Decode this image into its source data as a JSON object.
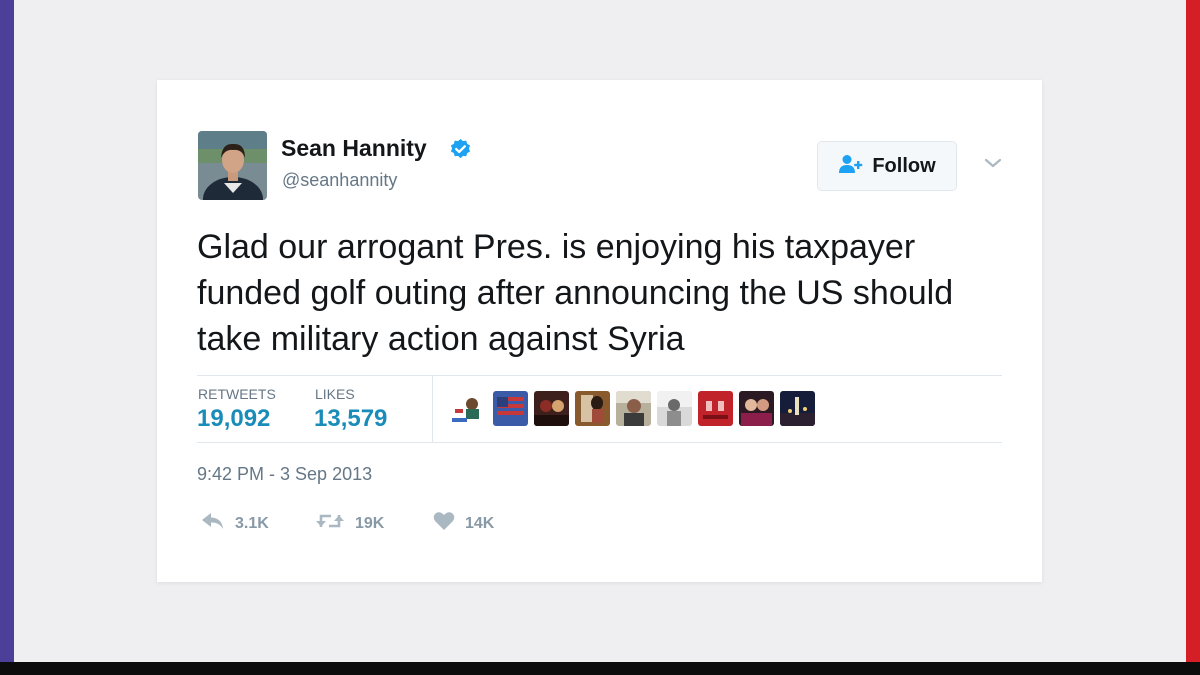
{
  "tweet": {
    "display_name": "Sean Hannity",
    "handle": "@seanhannity",
    "follow_label": "Follow",
    "text": "Glad our arrogant Pres. is enjoying his taxpayer funded golf outing after announcing the US should take military action against Syria",
    "stats": {
      "retweets_label": "RETWEETS",
      "retweets_value": "19,092",
      "likes_label": "LIKES",
      "likes_value": "13,579"
    },
    "timestamp": "9:42 PM - 3 Sep 2013",
    "actions": {
      "reply_count": "3.1K",
      "retweet_count": "19K",
      "like_count": "14K"
    },
    "liker_avatar_count": 9
  },
  "colors": {
    "accent_blue": "#1da1f2",
    "stat_value": "#1a8cba",
    "text_primary": "#14171a",
    "text_secondary": "#657786",
    "frame_left": "#4b3f99",
    "frame_right": "#d51f27"
  },
  "icons": {
    "verified": "verified-badge-icon",
    "follow": "add-user-icon",
    "menu": "chevron-down-icon",
    "reply": "reply-icon",
    "retweet": "retweet-icon",
    "like": "heart-icon"
  }
}
